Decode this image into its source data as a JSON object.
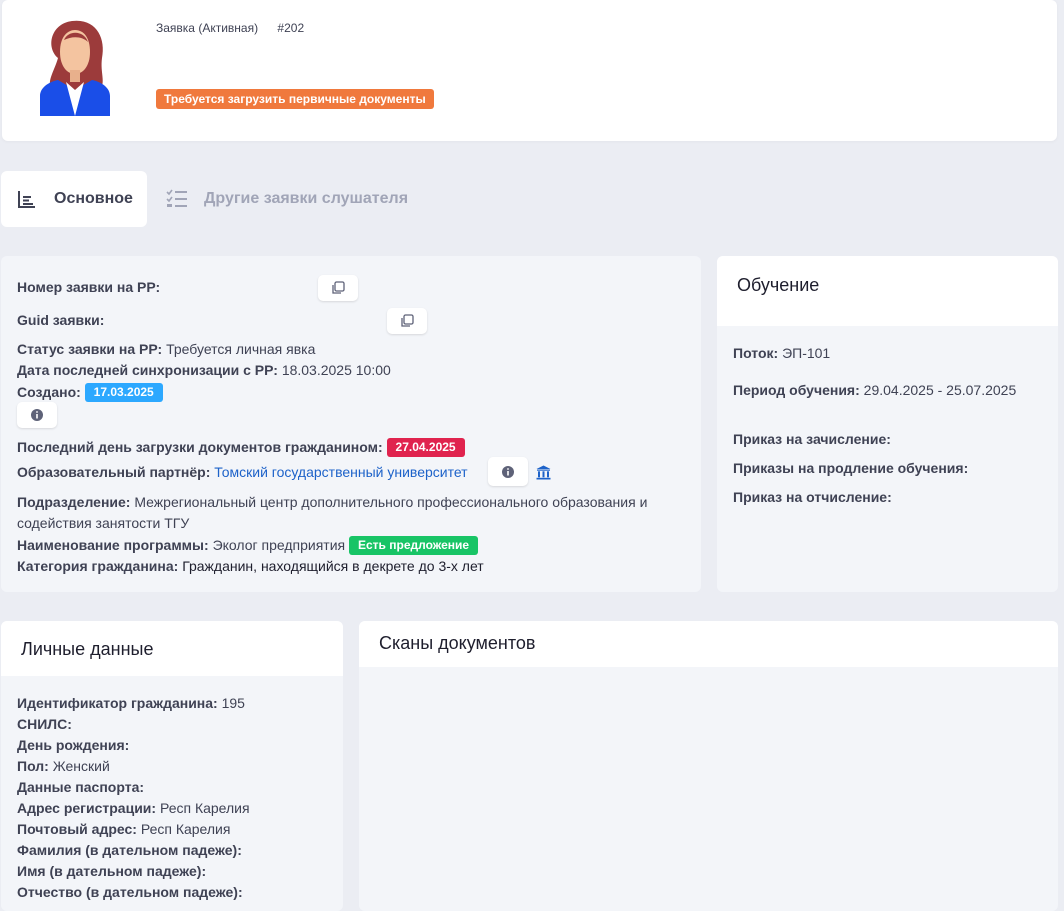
{
  "header": {
    "title": "Заявка (Активная)",
    "number": "#202",
    "status_badge": "Требуется загрузить первичные документы",
    "avatar_icon": "female-user-avatar-icon"
  },
  "tabs": [
    {
      "label": "Основное",
      "icon": "bar-chart-icon",
      "active": true
    },
    {
      "label": "Другие заявки слушателя",
      "icon": "checklist-icon",
      "active": false
    }
  ],
  "info": {
    "rr_number_label": "Номер заявки на РР:",
    "guid_label": "Guid заявки:",
    "rr_status_label": "Статус заявки на РР:",
    "rr_status_value": "Требуется личная явка",
    "sync_label": "Дата последней синхронизации с РР:",
    "sync_value": "18.03.2025 10:00",
    "created_label": "Создано:",
    "created_value": "17.03.2025",
    "last_day_label": "Последний день загрузки документов гражданином:",
    "last_day_value": "27.04.2025",
    "partner_label": "Образовательный партнёр:",
    "partner_value": "Томский государственный университет",
    "division_label": "Подразделение:",
    "division_value_line1": "Межрегиональный центр дополнительного профессионального образования и",
    "division_value_line2": "содействия занятости ТГУ",
    "program_label": "Наименование программы:",
    "program_value": "Эколог предприятия",
    "program_badge": "Есть предложение",
    "category_label": "Категория гражданина:",
    "category_value": "Гражданин, находящийся в декрете до 3-х лет"
  },
  "study": {
    "title": "Обучение",
    "stream_label": "Поток:",
    "stream_value": "ЭП-101",
    "period_label": "Период обучения:",
    "period_value": "29.04.2025 - 25.07.2025",
    "enroll_label": "Приказ на зачисление:",
    "extend_label": "Приказы на продление обучения:",
    "expel_label": "Приказ на отчисление:"
  },
  "personal": {
    "title": "Личные данные",
    "rows": [
      {
        "label": "Идентификатор гражданина:",
        "value": "195"
      },
      {
        "label": "СНИЛС:",
        "value": ""
      },
      {
        "label": "День рождения:",
        "value": ""
      },
      {
        "label": "Пол:",
        "value": "Женский"
      },
      {
        "label": "Данные паспорта:",
        "value": ""
      },
      {
        "label": "Адрес регистрации:",
        "value": "Респ Карелия"
      },
      {
        "label": "Почтовый адрес:",
        "value": "Респ Карелия"
      },
      {
        "label": "Фамилия (в дательном падеже):",
        "value": ""
      },
      {
        "label": "Имя (в дательном падеже):",
        "value": ""
      },
      {
        "label": "Отчество (в дательном падеже):",
        "value": ""
      }
    ]
  },
  "scans": {
    "title": "Сканы документов"
  },
  "colors": {
    "background": "#ebedf3",
    "status_orange": "#f0793d",
    "badge_blue": "#2ca8ff",
    "badge_red": "#e0234e",
    "badge_green": "#18c466",
    "link_blue": "#1d62c9"
  }
}
